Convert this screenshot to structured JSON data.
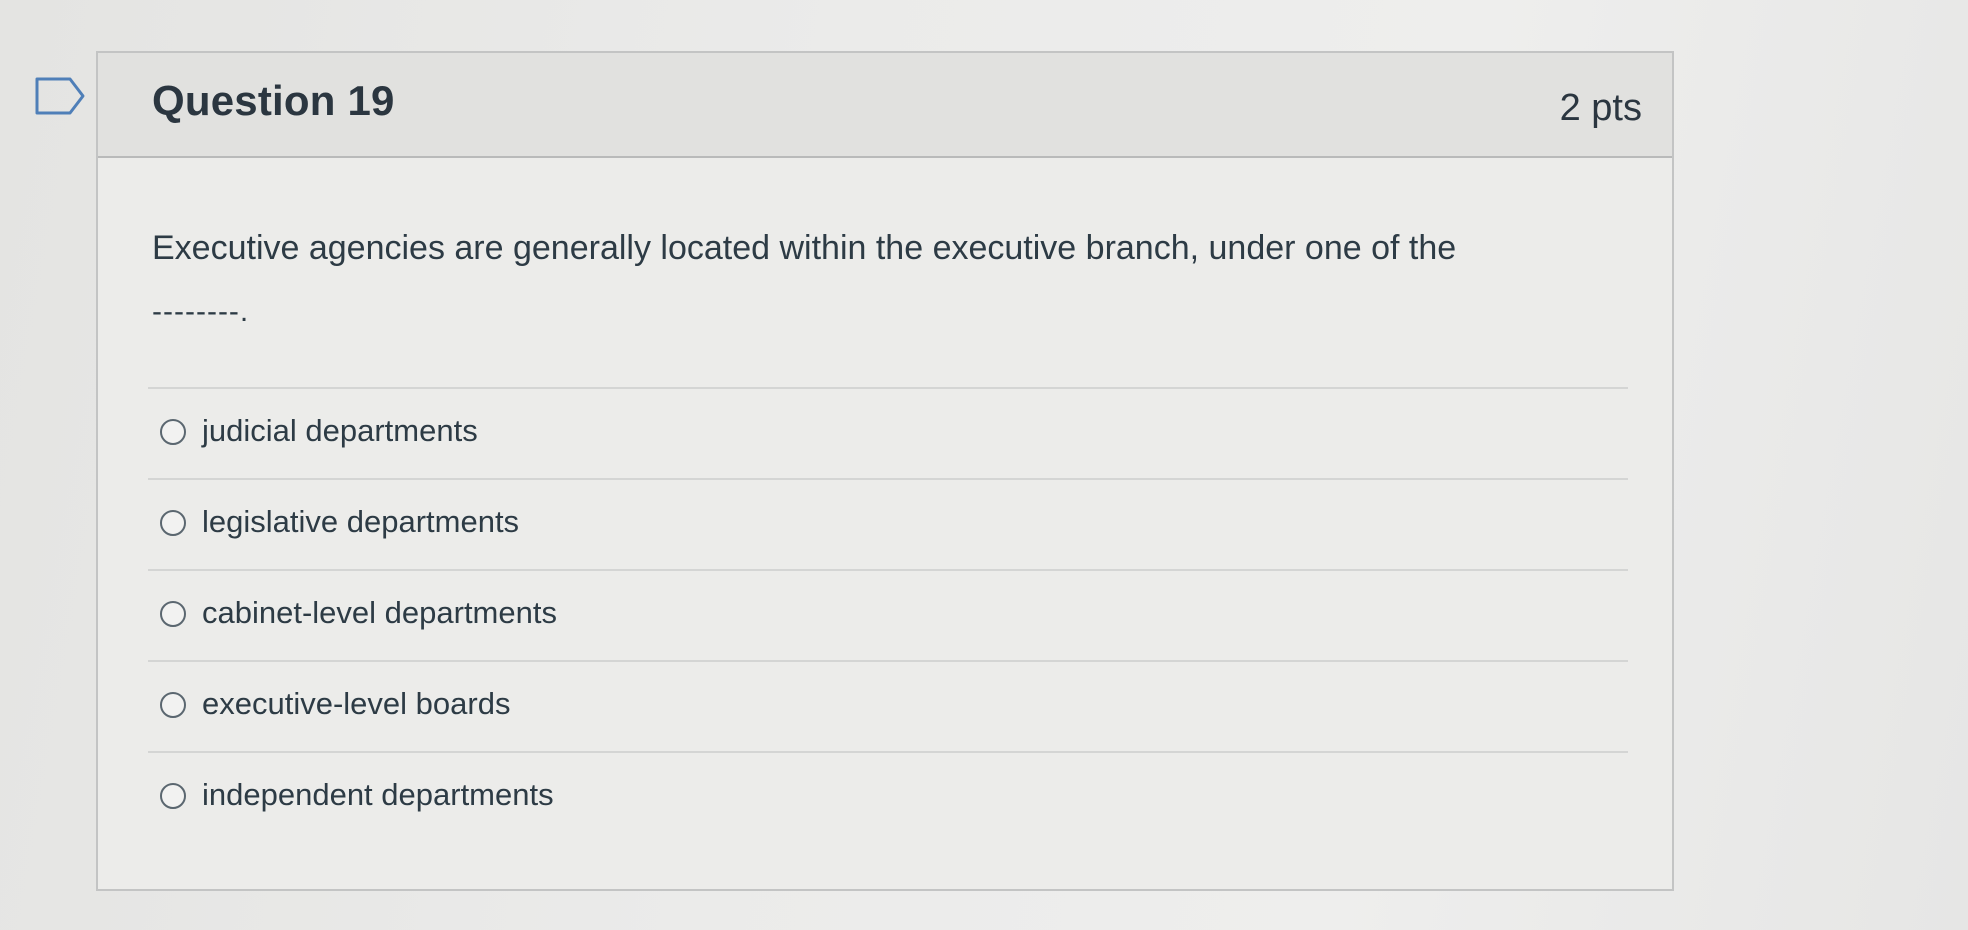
{
  "question": {
    "title": "Question 19",
    "points": "2 pts",
    "text": "Executive agencies are generally located within the executive branch, under one of the",
    "blank": "--------."
  },
  "answers": [
    {
      "label": "judicial departments",
      "selected": false
    },
    {
      "label": "legislative departments",
      "selected": false
    },
    {
      "label": "cabinet-level departments",
      "selected": false
    },
    {
      "label": "executive-level boards",
      "selected": false
    },
    {
      "label": "independent departments",
      "selected": false
    }
  ],
  "icons": {
    "flag": "flag-outline-icon",
    "radio": "radio-unchecked-icon"
  },
  "colors": {
    "text": "#2d3b45",
    "header_bg": "#e1e1df",
    "border": "#c3c4c4"
  }
}
